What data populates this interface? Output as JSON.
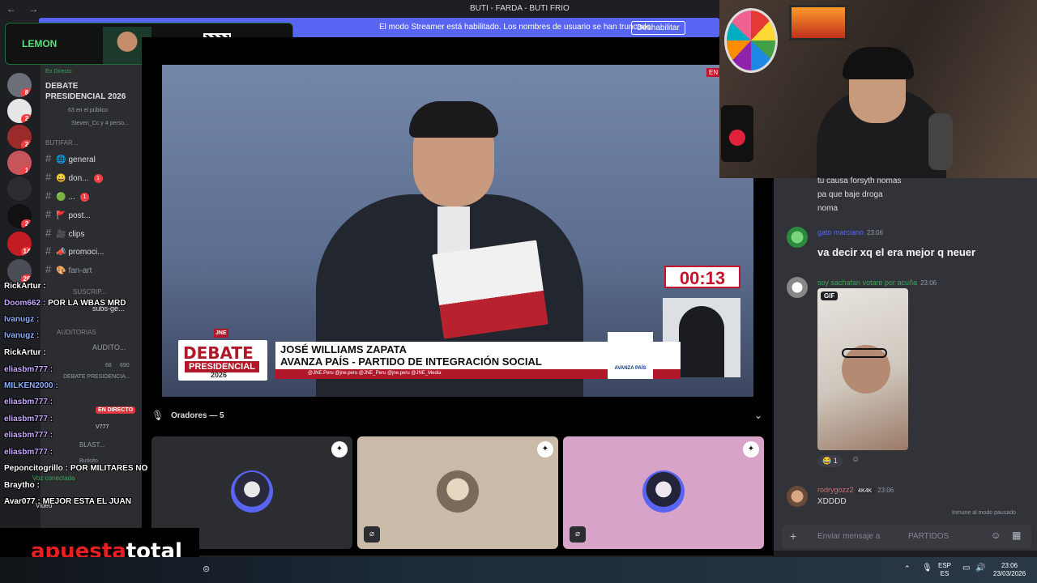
{
  "window": {
    "title": "BUTI - FARDA - BUTI FRIO",
    "nav": "←  →"
  },
  "banner": {
    "text": "El modo Streamer está habilitado. Los nombres de usuario se han truncado.",
    "button": "Deshabilitar"
  },
  "lemon": {
    "logo": "LEMON"
  },
  "rail": {
    "badges": [
      "8",
      "2",
      "2",
      "1",
      "2",
      "14",
      "26"
    ]
  },
  "sidebar": {
    "live_label": "En Directo",
    "event_title": "DEBATE PRESIDENCIAL 2026",
    "public_count": "63 en el público",
    "attendees": "Steven_Cc y 4 perso...",
    "category1": "BUTIFAR...",
    "channels": [
      {
        "icon": "🌐",
        "label": "general",
        "badge": ""
      },
      {
        "icon": "😀",
        "label": "don...",
        "badge": "1"
      },
      {
        "icon": "🟢",
        "label": "...",
        "badge": "1"
      },
      {
        "icon": "🚩",
        "label": "post...",
        "badge": ""
      },
      {
        "icon": "🎥",
        "label": "clips",
        "badge": ""
      },
      {
        "icon": "📣",
        "label": "promoci...",
        "badge": ""
      },
      {
        "icon": "🎨",
        "label": "fan-art",
        "badge": ""
      }
    ],
    "category2": "SUSCRIP...",
    "subs_channel": "subs-ge...",
    "category3": "AUDITORIAS",
    "audit_channel": "AUDITO...",
    "debate_channel": "DEBATE PRESIDENCIA...",
    "debate_count1": "68",
    "debate_count2": "690",
    "en_directo": "EN DIRECTO",
    "user_v": "V777",
    "user_blast": "BLAST...",
    "user_butisito": "Butisito",
    "voice_connected": "Voz conectada",
    "video": "Video"
  },
  "stream_chat": [
    {
      "user": "RickArtur :",
      "msg": ""
    },
    {
      "user": "Doom662 :",
      "msg": "POR LA WBAS MRD"
    },
    {
      "user": "Ivanugz :",
      "msg": ""
    },
    {
      "user": "Ivanugz :",
      "msg": ""
    },
    {
      "user": "RickArtur :",
      "msg": ""
    },
    {
      "user": "eliasbm777 :",
      "msg": ""
    },
    {
      "user": "MILKEN2000 :",
      "msg": ""
    },
    {
      "user": "eliasbm777 :",
      "msg": ""
    },
    {
      "user": "eliasbm777 :",
      "msg": ""
    },
    {
      "user": "eliasbm777 :",
      "msg": ""
    },
    {
      "user": "eliasbm777 :",
      "msg": ""
    },
    {
      "user": "Peponcitogrillo :",
      "msg": "POR MILITARES NO"
    },
    {
      "user": "Braytho :",
      "msg": ""
    },
    {
      "user": "Avar077 :",
      "msg": "MEJOR ESTA EL JUAN"
    }
  ],
  "stream": {
    "en_vivo": "EN",
    "timer": "00:13",
    "lower_third": {
      "debate": "DEBATE",
      "presidencial": "PRESIDENCIAL",
      "year": "2026",
      "line1": "JOSÉ WILLIAMS ZAPATA",
      "line2": "AVANZA PAÍS - PARTIDO DE INTEGRACIÓN SOCIAL",
      "social": "@JNE.Peru   @jne.peru   @JNE_Peru   @jne.peru   @JNE_Media",
      "jne": "JNE"
    },
    "party": "AVANZA PAÍS"
  },
  "speakers": {
    "label": "Oradores — 5"
  },
  "tiles": [
    {
      "bg": "#2b2d31"
    },
    {
      "bg": "#c9bba8"
    },
    {
      "bg": "#d8a3c9"
    }
  ],
  "brand": {
    "apuesta": "apuesta",
    "total": "total"
  },
  "chat": {
    "lines": [
      "tu causa forsyth nomas",
      "pa que baje droga",
      "noma"
    ],
    "messages": [
      {
        "user": "gato marciano",
        "color": "#5865f2",
        "time": "23:06",
        "text": "va decir xq el era mejor q neuer"
      },
      {
        "user": "soy sachafan votare por acuña",
        "color": "#3ba55c",
        "time": "23:06",
        "gif": "GIF",
        "reaction_count": "1"
      },
      {
        "user": "rodrygozz2",
        "color": "#d07070",
        "time": "23:06",
        "tag": "4K4K",
        "text": "XDDDD"
      }
    ],
    "immune": "Inmune al modo pausado",
    "input_placeholder": "Enviar mensaje a",
    "channel": "PARTIDOS"
  },
  "taskbar": {
    "lang1": "ESP",
    "lang2": "ES",
    "time": "23:06",
    "date": "23/03/2026"
  }
}
